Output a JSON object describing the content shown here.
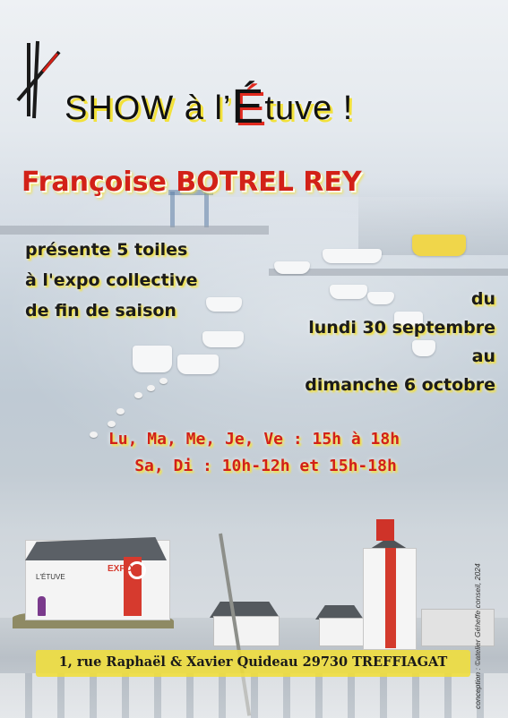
{
  "poster": {
    "title_prefix": "SHOW à l’",
    "title_big_letter": "É",
    "title_suffix": "tuve !",
    "artist": "Françoise BOTREL REY",
    "presents_lines": [
      "présente 5 toiles",
      "à l'expo collective",
      "de fin de saison"
    ],
    "dates_lines": [
      "du",
      "lundi 30 septembre",
      "au",
      "dimanche 6 octobre"
    ],
    "hours_lines": [
      "Lu, Ma, Me, Je, Ve : 15h à 18h",
      "Sa, Di : 10h-12h et 15h-18h"
    ],
    "address": "1, rue Raphaël & Xavier Quideau 29730 TREFFIAGAT",
    "credit": "conception : ©atelier Géheffe conseil, 2024",
    "building_sign": "EXPO",
    "building_logo": "L'ÉTUVE"
  },
  "colors": {
    "accent_red": "#d22118",
    "highlight_yellow": "#f0de36",
    "text_dark": "#1b1b1b"
  },
  "icons": {
    "logo": "crossed-paintbrushes-icon"
  }
}
